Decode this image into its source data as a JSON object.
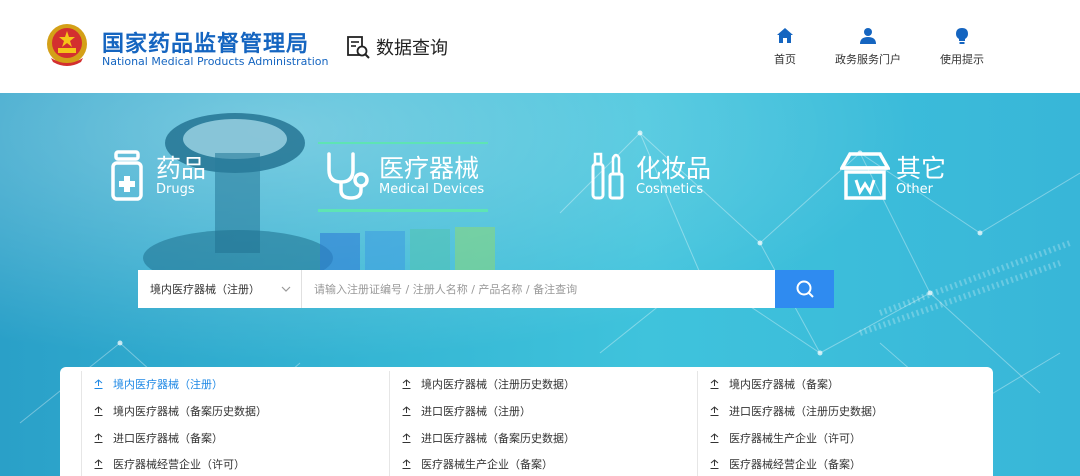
{
  "header": {
    "brand_cn": "国家药品监督管理局",
    "brand_en": "National Medical Products Administration",
    "data_query_label": "数据查询",
    "nav": [
      {
        "label": "首页",
        "icon": "home-icon"
      },
      {
        "label": "政务服务门户",
        "icon": "user-icon"
      },
      {
        "label": "使用提示",
        "icon": "lightbulb-icon"
      }
    ]
  },
  "categories": [
    {
      "cn": "药品",
      "en": "Drugs",
      "icon": "medicine-bottle-icon",
      "active": false
    },
    {
      "cn": "医疗器械",
      "en": "Medical Devices",
      "icon": "stethoscope-icon",
      "active": true
    },
    {
      "cn": "化妆品",
      "en": "Cosmetics",
      "icon": "cosmetics-icon",
      "active": false
    },
    {
      "cn": "其它",
      "en": "Other",
      "icon": "store-icon",
      "active": false
    }
  ],
  "search": {
    "select_value": "境内医疗器械（注册）",
    "placeholder": "请输入注册证编号 / 注册人名称 / 产品名称 / 备注查询"
  },
  "links": {
    "col1": [
      "境内医疗器械（注册）",
      "境内医疗器械（备案历史数据）",
      "进口医疗器械（备案）",
      "医疗器械经营企业（许可）"
    ],
    "col2": [
      "境内医疗器械（注册历史数据）",
      "进口医疗器械（注册）",
      "进口医疗器械（备案历史数据）",
      "医疗器械生产企业（备案）"
    ],
    "col3": [
      "境内医疗器械（备案）",
      "进口医疗器械（注册历史数据）",
      "医疗器械生产企业（许可）",
      "医疗器械经营企业（备案）"
    ]
  },
  "colors": {
    "brand_blue": "#1565c0",
    "search_button": "#2f8bf0",
    "active_link": "#1e88e5",
    "active_underline": "#5ee4b4"
  }
}
